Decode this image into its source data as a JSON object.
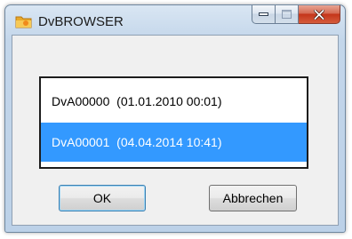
{
  "window": {
    "title": "DvBROWSER",
    "icon": "folder-icon"
  },
  "caption_buttons": {
    "minimize": "minimize-icon",
    "maximize": "maximize-icon",
    "close": "close-icon"
  },
  "list": {
    "items": [
      {
        "label": "DvA00000  (01.01.2010 00:01)",
        "selected": false
      },
      {
        "label": "DvA00001  (04.04.2014 10:41)",
        "selected": true
      }
    ]
  },
  "buttons": {
    "ok_label": "OK",
    "cancel_label": "Abbrechen"
  },
  "colors": {
    "selection": "#3399ff",
    "close_button": "#c4351a"
  }
}
